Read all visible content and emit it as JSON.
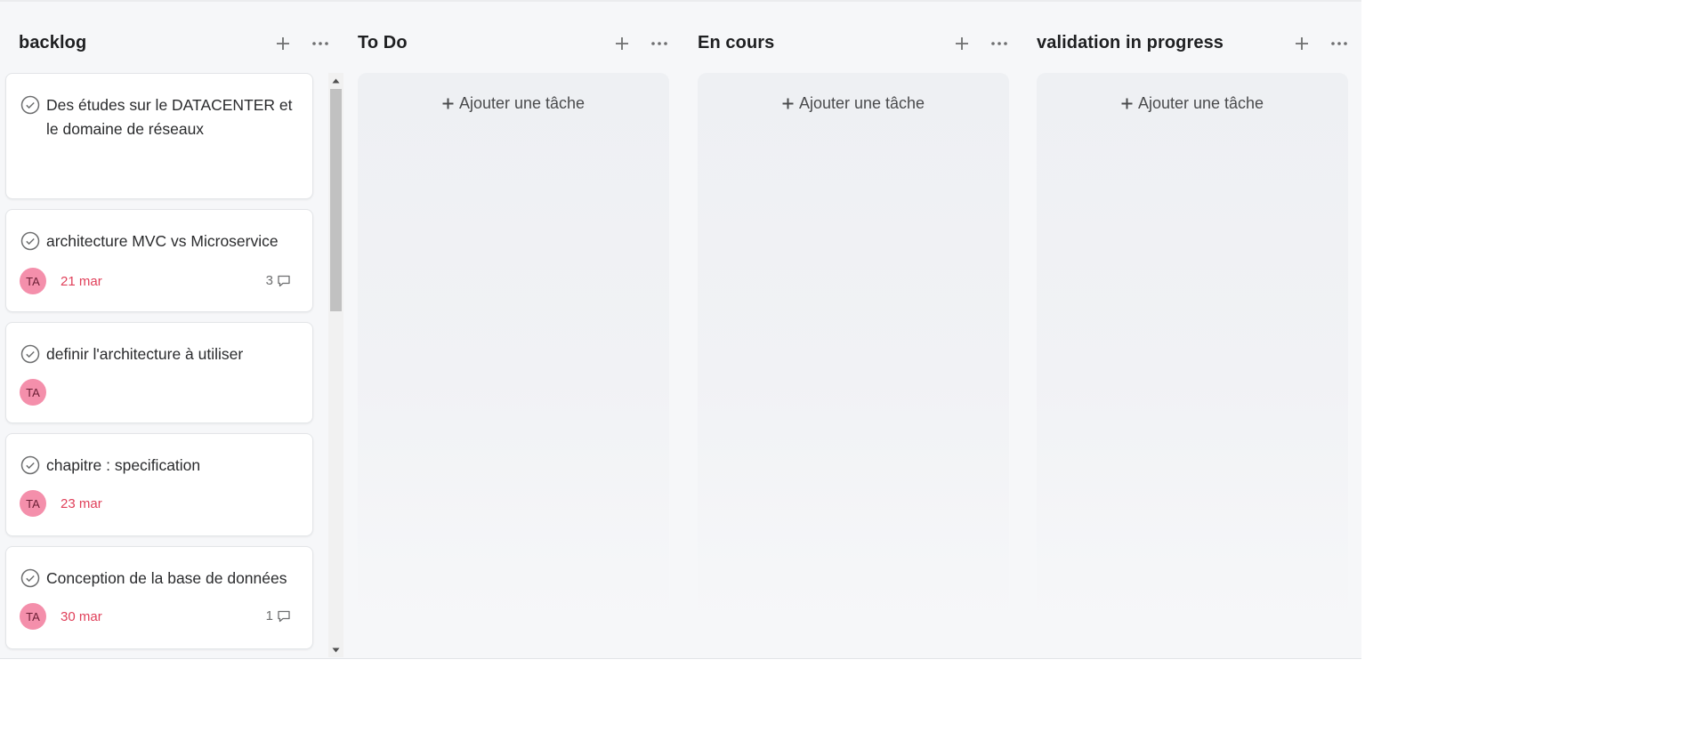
{
  "columns": [
    {
      "title": "backlog"
    },
    {
      "title": "To Do",
      "add_task": "Ajouter une tâche"
    },
    {
      "title": "En cours",
      "add_task": "Ajouter une tâche"
    },
    {
      "title": "validation in progress",
      "add_task": "Ajouter une tâche"
    }
  ],
  "cards": [
    {
      "title": "Des études sur le DATACENTER et le domaine de réseaux"
    },
    {
      "title": "architecture MVC vs Microservice",
      "assignee": "TA",
      "due": "21 mar",
      "comments": "3"
    },
    {
      "title": "definir l'architecture à utiliser",
      "assignee": "TA"
    },
    {
      "title": "chapitre : specification",
      "assignee": "TA",
      "due": "23 mar"
    },
    {
      "title": "Conception de la base de données",
      "assignee": "TA",
      "due": "30 mar",
      "comments": "1"
    }
  ],
  "colors": {
    "due_date": "#e0405a",
    "avatar_bg": "#f48fab",
    "board_bg": "#f6f7f9"
  },
  "icons": {
    "add": "plus-icon",
    "more": "ellipsis-icon",
    "complete": "check-circle-icon",
    "comment": "speech-bubble-icon"
  }
}
